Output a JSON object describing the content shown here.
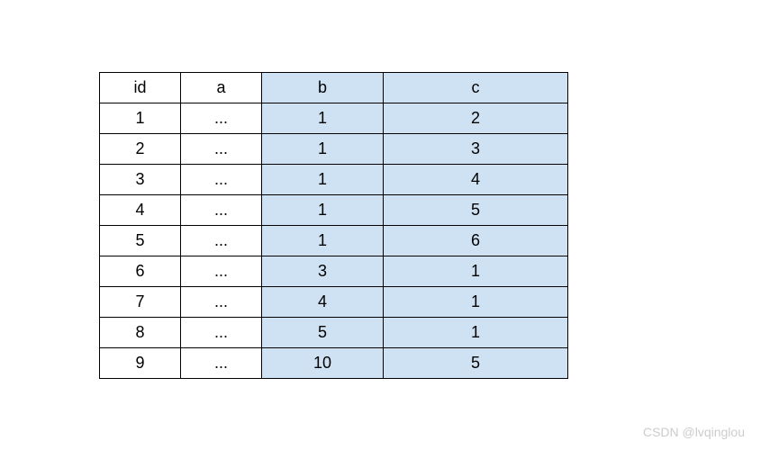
{
  "table": {
    "headers": [
      "id",
      "a",
      "b",
      "c"
    ],
    "rows": [
      {
        "id": "1",
        "a": "...",
        "b": "1",
        "c": "2"
      },
      {
        "id": "2",
        "a": "...",
        "b": "1",
        "c": "3"
      },
      {
        "id": "3",
        "a": "...",
        "b": "1",
        "c": "4"
      },
      {
        "id": "4",
        "a": "...",
        "b": "1",
        "c": "5"
      },
      {
        "id": "5",
        "a": "...",
        "b": "1",
        "c": "6"
      },
      {
        "id": "6",
        "a": "...",
        "b": "3",
        "c": "1"
      },
      {
        "id": "7",
        "a": "...",
        "b": "4",
        "c": "1"
      },
      {
        "id": "8",
        "a": "...",
        "b": "5",
        "c": "1"
      },
      {
        "id": "9",
        "a": "...",
        "b": "10",
        "c": "5"
      }
    ]
  },
  "watermark": "CSDN @lvqinglou",
  "chart_data": {
    "type": "table",
    "title": "",
    "columns": [
      "id",
      "a",
      "b",
      "c"
    ],
    "highlighted_columns": [
      "b",
      "c"
    ],
    "data": [
      [
        1,
        "...",
        1,
        2
      ],
      [
        2,
        "...",
        1,
        3
      ],
      [
        3,
        "...",
        1,
        4
      ],
      [
        4,
        "...",
        1,
        5
      ],
      [
        5,
        "...",
        1,
        6
      ],
      [
        6,
        "...",
        3,
        1
      ],
      [
        7,
        "...",
        4,
        1
      ],
      [
        8,
        "...",
        5,
        1
      ],
      [
        9,
        "...",
        10,
        5
      ]
    ]
  }
}
